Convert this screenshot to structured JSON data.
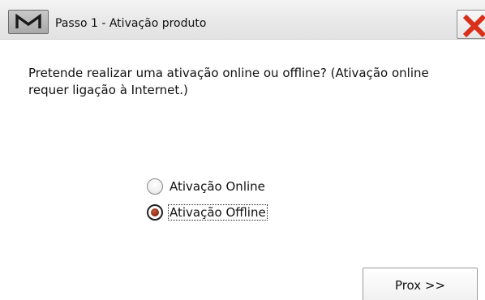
{
  "window": {
    "title": "Passo 1 - Ativação produto",
    "app_icon": "m-logo-icon",
    "close_icon": "close-x-icon",
    "close_color": "#d9301a"
  },
  "main": {
    "prompt": "Pretende realizar uma ativação online ou offline? (Ativação online requer ligação à Internet.)",
    "options": [
      {
        "label": "Ativação Online",
        "checked": false
      },
      {
        "label": "Ativação Offline",
        "checked": true
      }
    ]
  },
  "footer": {
    "next_label": "Prox >>"
  }
}
